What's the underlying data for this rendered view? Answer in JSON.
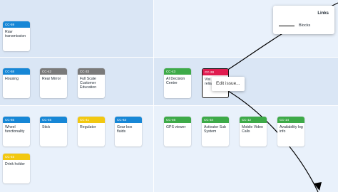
{
  "colors": {
    "row_band_dark": "#dae6f5",
    "row_band_light": "#e9f1fb",
    "key_blue": "#1787d6",
    "key_gray": "#7a7a7a",
    "key_yellow": "#f2c811",
    "key_green": "#3daa48",
    "key_red": "#e01b4f",
    "link_line": "#000000"
  },
  "legend": {
    "title": "Links",
    "items": [
      {
        "label": "Blocks"
      }
    ]
  },
  "tooltip": {
    "label": "Edit issue..."
  },
  "cards": [
    {
      "key": "CC-59",
      "title": "Raw transmission",
      "color": "blue"
    },
    {
      "key": "CC-58",
      "title": "Housing",
      "color": "blue"
    },
    {
      "key": "CC-42",
      "title": "Rear Mirror",
      "color": "gray"
    },
    {
      "key": "CC-33",
      "title": "Full Scale Customer Education",
      "color": "gray"
    },
    {
      "key": "CC-43",
      "title": "AI Decision Centre",
      "color": "green"
    },
    {
      "key": "CC-28",
      "title": "Visi\nrelia",
      "color": "red"
    },
    {
      "key": "CC-65",
      "title": "Wheel functionality",
      "color": "blue"
    },
    {
      "key": "CC-45",
      "title": "Stick",
      "color": "blue"
    },
    {
      "key": "CC-41",
      "title": "Regulator",
      "color": "yellow"
    },
    {
      "key": "CC-63",
      "title": "Gear box fluids",
      "color": "blue"
    },
    {
      "key": "CC-46",
      "title": "GPS viewer",
      "color": "green"
    },
    {
      "key": "CC-34",
      "title": "Activator Sub System",
      "color": "green"
    },
    {
      "key": "CC-12",
      "title": "Mobile Video Calls",
      "color": "green"
    },
    {
      "key": "CC-14",
      "title": "Availability log info",
      "color": "green"
    },
    {
      "key": "CC-45",
      "title": "Drink holder",
      "color": "yellow"
    }
  ]
}
